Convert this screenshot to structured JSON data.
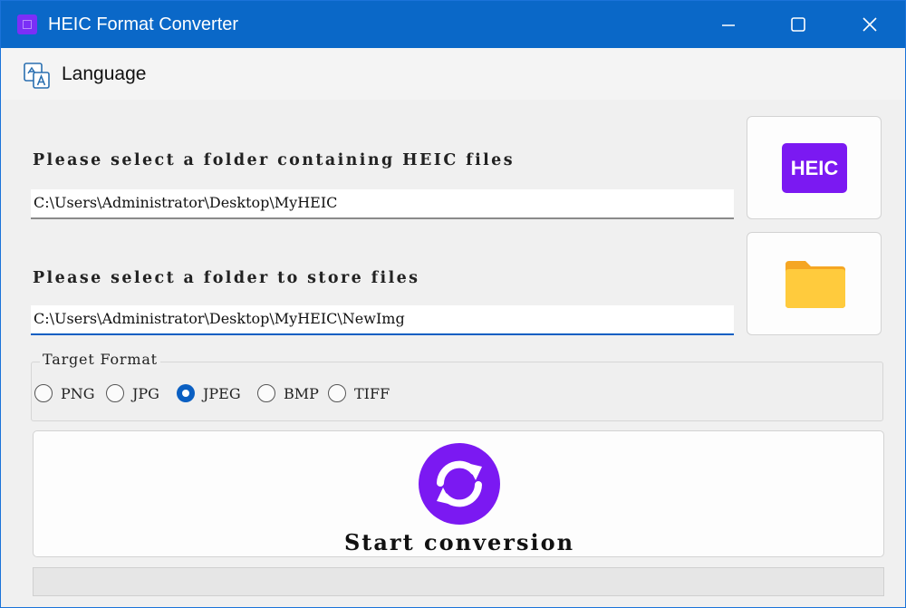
{
  "window": {
    "title": "HEIC Format Converter"
  },
  "menu": {
    "language_label": "Language"
  },
  "source": {
    "label": "Please select a folder containing HEIC files",
    "path": "C:\\Users\\Administrator\\Desktop\\MyHEIC",
    "button_badge": "HEIC"
  },
  "output": {
    "label": "Please select a folder to store files",
    "path": "C:\\Users\\Administrator\\Desktop\\MyHEIC\\NewImg"
  },
  "format": {
    "legend": "Target Format",
    "options": [
      "PNG",
      "JPG",
      "JPEG",
      "BMP",
      "TIFF"
    ],
    "selected": "JPEG"
  },
  "start": {
    "label": "Start conversion",
    "icon": "sync-icon"
  },
  "progress": {
    "value": 0
  },
  "colors": {
    "titlebar": "#0a68c8",
    "accent": "#7b19f2",
    "radio_checked": "#0a5fc2",
    "folder": "#ffc83d"
  }
}
